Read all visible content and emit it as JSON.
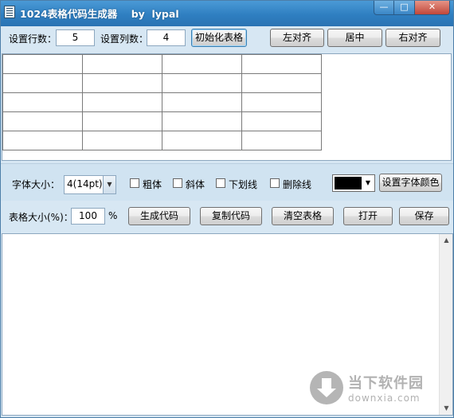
{
  "window": {
    "title": "1024表格代码生成器    by  lypal",
    "caption": {
      "minimize": "—",
      "maximize": "□",
      "close": "✕"
    }
  },
  "setup": {
    "rows_label": "设置行数：",
    "rows_value": "5",
    "cols_label": "设置列数：",
    "cols_value": "4",
    "init_button": "初始化表格",
    "align_left": "左对齐",
    "align_center": "居中",
    "align_right": "右对齐"
  },
  "table_grid": {
    "rows": 5,
    "cols": 4
  },
  "font": {
    "size_label": "字体大小：",
    "size_value": "4(14pt)",
    "bold": "粗体",
    "italic": "斜体",
    "underline": "下划线",
    "strikethrough": "删除线",
    "color": "#000000",
    "set_color_button": "设置字体颜色"
  },
  "actions": {
    "table_size_label": "表格大小(%)：",
    "table_size_value": "100",
    "percent": "%",
    "generate": "生成代码",
    "copy": "复制代码",
    "clear": "清空表格",
    "open": "打开",
    "save": "保存"
  },
  "output": {
    "text": ""
  },
  "watermark": {
    "brand": "当下软件园",
    "url": "downxia.com"
  },
  "icons": {
    "app": "app-icon",
    "select_arrow": "chevron-down-icon",
    "scroll_up": "scroll-up-icon",
    "scroll_down": "scroll-down-icon",
    "watermark": "download-logo-icon"
  }
}
